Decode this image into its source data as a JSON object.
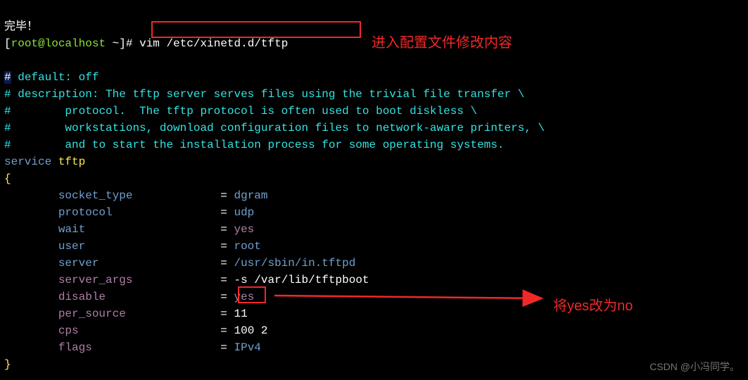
{
  "line_done": "完毕！",
  "prompt": {
    "user": "root",
    "host": "localhost",
    "path": "~",
    "symbol": "#"
  },
  "command": "vim /etc/xinetd.d/tftp",
  "comments": {
    "default": "default: off",
    "desc1": "description: The tftp server serves files using the trivial file transfer \\",
    "desc2": "       protocol.  The tftp protocol is often used to boot diskless \\",
    "desc3": "       workstations, download configuration files to network-aware printers, \\",
    "desc4": "       and to start the installation process for some operating systems."
  },
  "service_kw": "service",
  "service_name": "tftp",
  "brace_open": "{",
  "brace_close": "}",
  "pad": "        ",
  "fields": {
    "socket_type": {
      "label": "socket_type",
      "eq": "=",
      "value": "dgram"
    },
    "protocol": {
      "label": "protocol",
      "eq": "=",
      "value": "udp"
    },
    "wait": {
      "label": "wait",
      "eq": "=",
      "value": "yes"
    },
    "user": {
      "label": "user",
      "eq": "=",
      "value": "root"
    },
    "server": {
      "label": "server",
      "eq": "=",
      "value": "/usr/sbin/in.tftpd"
    },
    "server_args": {
      "label": "server_args",
      "eq": "=",
      "value": "-s /var/lib/tftpboot"
    },
    "disable": {
      "label": "disable",
      "eq": "=",
      "value": "yes"
    },
    "per_source": {
      "label": "per_source",
      "eq": "=",
      "value": "11"
    },
    "cps": {
      "label": "cps",
      "eq": "=",
      "value": "100 2"
    },
    "flags": {
      "label": "flags",
      "eq": "=",
      "value": "IPv4"
    }
  },
  "hash": "#",
  "annotation1": "进入配置文件修改内容",
  "annotation2": "将yes改为no",
  "watermark": "CSDN @小冯同学。"
}
